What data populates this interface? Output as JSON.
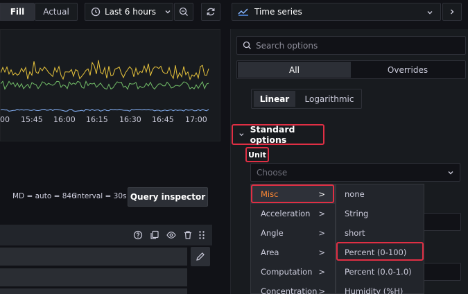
{
  "toolbar": {
    "fill_label": "Fill",
    "actual_label": "Actual",
    "time_range": "Last 6 hours",
    "visualization": "Time series"
  },
  "graph": {
    "x_ticks": [
      "00",
      "15:45",
      "16:00",
      "16:15",
      "16:30",
      "16:45",
      "17:00"
    ],
    "series_colors": [
      "#e8c43c",
      "#73bf69",
      "#8ab8ff"
    ]
  },
  "query": {
    "max_data_points": "MD = auto = 846",
    "interval": "Interval = 30s",
    "inspector_label": "Query inspector"
  },
  "options": {
    "search_placeholder": "Search options",
    "tab_all": "All",
    "tab_overrides": "Overrides",
    "scale_linear": "Linear",
    "scale_log": "Logarithmic",
    "section_title": "Standard options",
    "unit_label": "Unit",
    "unit_placeholder": "Choose"
  },
  "unit_menu": {
    "categories": [
      {
        "label": "Misc",
        "arrow": ">"
      },
      {
        "label": "Acceleration",
        "arrow": ">"
      },
      {
        "label": "Angle",
        "arrow": ">"
      },
      {
        "label": "Area",
        "arrow": ">"
      },
      {
        "label": "Computation",
        "arrow": ">"
      },
      {
        "label": "Concentration",
        "arrow": ">"
      }
    ],
    "units": [
      "none",
      "String",
      "short",
      "Percent (0-100)",
      "Percent (0.0-1.0)",
      "Humidity (%H)"
    ]
  },
  "colors": {
    "highlight": "#e02f44",
    "misc_text": "#ff8833"
  }
}
